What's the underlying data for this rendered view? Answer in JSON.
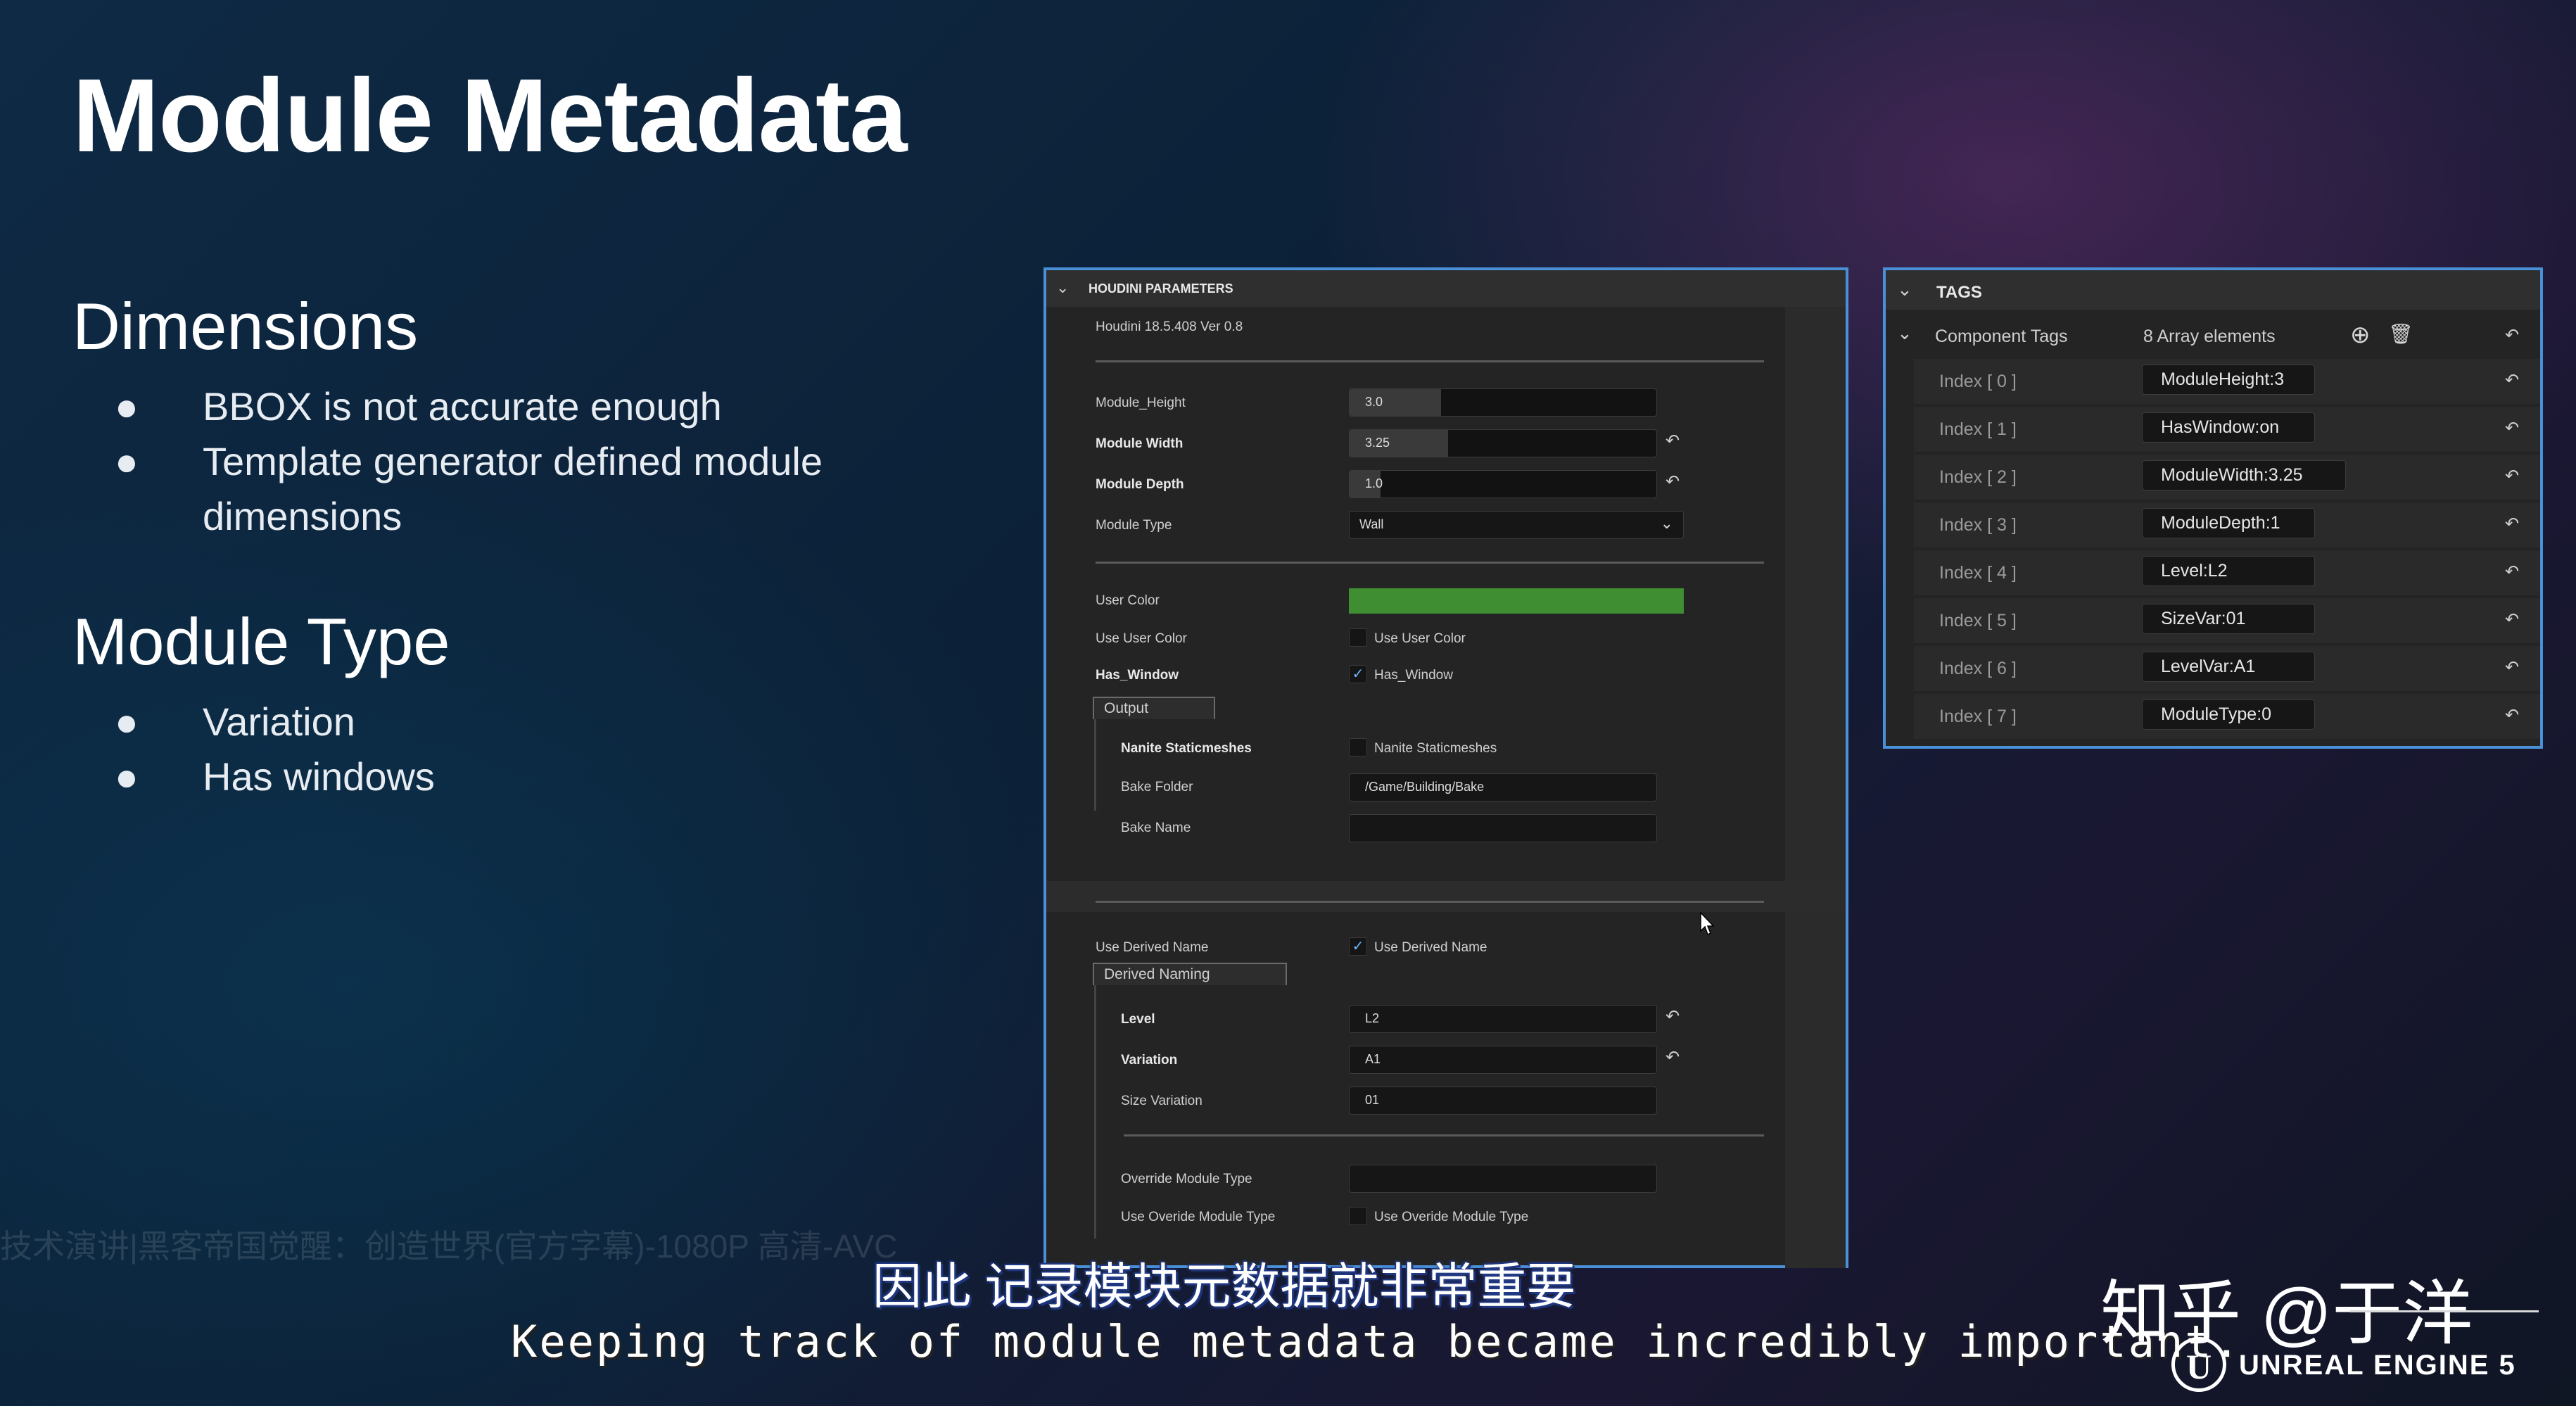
{
  "slide": {
    "title": "Module Metadata",
    "sections": [
      {
        "heading": "Dimensions",
        "bullets": [
          "BBOX is not accurate enough",
          "Template generator defined module",
          "dimensions"
        ]
      },
      {
        "heading": "Module Type",
        "bullets": [
          "Variation",
          "Has windows"
        ]
      }
    ],
    "bullet_glyph": "●"
  },
  "houdini": {
    "header": "HOUDINI PARAMETERS",
    "version": "Houdini 18.5.408 Ver 0.8",
    "module_height_label": "Module_Height",
    "module_height_value": "3.0",
    "module_width_label": "Module Width",
    "module_width_value": "3.25",
    "module_depth_label": "Module Depth",
    "module_depth_value": "1.0",
    "module_type_label": "Module Type",
    "module_type_value": "Wall",
    "user_color_label": "User Color",
    "user_color": "#3f8f32",
    "use_user_color_label": "Use User Color",
    "use_user_color_text": "Use User Color",
    "has_window_label": "Has_Window",
    "has_window_text": "Has_Window",
    "output_tab": "Output",
    "nanite_label": "Nanite Staticmeshes",
    "nanite_text": "Nanite Staticmeshes",
    "bake_folder_label": "Bake Folder",
    "bake_folder_value": "/Game/Building/Bake",
    "bake_name_label": "Bake Name",
    "bake_name_value": "",
    "use_derived_label": "Use Derived Name",
    "use_derived_text": "Use Derived Name",
    "derived_tab": "Derived Naming",
    "level_label": "Level",
    "level_value": "L2",
    "variation_label": "Variation",
    "variation_value": "A1",
    "size_variation_label": "Size Variation",
    "size_variation_value": "01",
    "override_label": "Override Module Type",
    "override_value": "",
    "use_override_label": "Use Overide Module Type",
    "use_override_text": "Use Overide Module Type",
    "checkmark": "✓",
    "reset_glyph": "↶"
  },
  "tags": {
    "header": "TAGS",
    "component_tags_label": "Component Tags",
    "array_count": "8 Array elements",
    "add_glyph": "⊕",
    "trash_glyph": "🗑",
    "reset_glyph": "↶",
    "rows": [
      {
        "index": "Index [ 0 ]",
        "value": "ModuleHeight:3"
      },
      {
        "index": "Index [ 1 ]",
        "value": "HasWindow:on"
      },
      {
        "index": "Index [ 2 ]",
        "value": "ModuleWidth:3.25"
      },
      {
        "index": "Index [ 3 ]",
        "value": "ModuleDepth:1"
      },
      {
        "index": "Index [ 4 ]",
        "value": "Level:L2"
      },
      {
        "index": "Index [ 5 ]",
        "value": "SizeVar:01"
      },
      {
        "index": "Index [ 6 ]",
        "value": "LevelVar:A1"
      },
      {
        "index": "Index [ 7 ]",
        "value": "ModuleType:0"
      }
    ]
  },
  "subtitles": {
    "chinese": "因此 记录模块元数据就非常重要",
    "english": "Keeping track of module metadata became incredibly important.",
    "background_title": "技术演讲|黑客帝国觉醒：创造世界(官方字幕)-1080P 高清-AVC"
  },
  "watermark": {
    "zhihu": "知乎 @于洋",
    "engine": "UNREAL ENGINE 5"
  }
}
